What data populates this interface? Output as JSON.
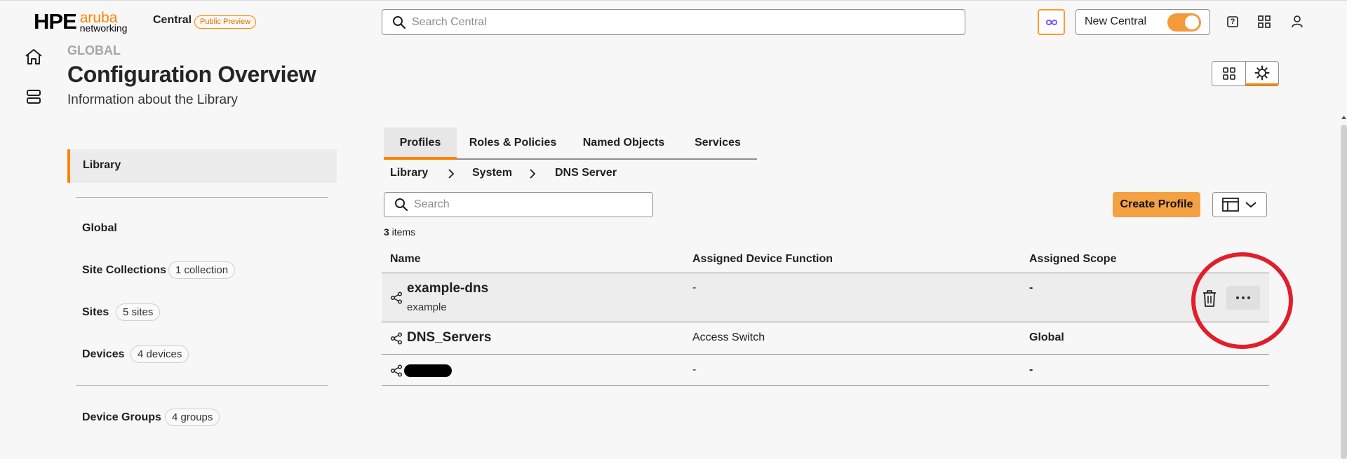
{
  "header": {
    "brand_hpe": "HPE",
    "brand_aruba": "aruba",
    "brand_networking": "networking",
    "app_name": "Central",
    "preview_badge": "Public Preview",
    "search_placeholder": "Search Central",
    "new_central_label": "New Central",
    "new_central_enabled": true,
    "help_glyph": "?"
  },
  "page": {
    "scope": "GLOBAL",
    "title": "Configuration Overview",
    "subtitle": "Information about the Library"
  },
  "left_nav": {
    "active": "Library",
    "items": [
      {
        "label": "Global",
        "count": ""
      },
      {
        "label": "Site Collections",
        "count": "1 collection"
      },
      {
        "label": "Sites",
        "count": "5 sites"
      },
      {
        "label": "Devices",
        "count": "4 devices"
      },
      {
        "label": "Device Groups",
        "count": "4 groups"
      }
    ]
  },
  "tabs": [
    {
      "label": "Profiles",
      "active": true
    },
    {
      "label": "Roles & Policies",
      "active": false
    },
    {
      "label": "Named Objects",
      "active": false
    },
    {
      "label": "Services",
      "active": false
    }
  ],
  "breadcrumb": [
    "Library",
    "System",
    "DNS Server"
  ],
  "toolbar": {
    "search_placeholder": "Search",
    "create_label": "Create Profile"
  },
  "item_count": {
    "number": "3",
    "suffix": " items"
  },
  "table": {
    "columns": [
      "Name",
      "Assigned Device Function",
      "Assigned Scope"
    ],
    "rows": [
      {
        "name": "example-dns",
        "description": "example",
        "device_function": "-",
        "scope": "-"
      },
      {
        "name": "DNS_Servers",
        "description": "",
        "device_function": "Access Switch",
        "scope": "Global"
      },
      {
        "name": "",
        "description": "",
        "device_function": "-",
        "scope": "-",
        "redacted": true
      }
    ]
  },
  "colors": {
    "accent": "#ff8300",
    "primary_button": "#f4a144",
    "annotation": "#e01f2b"
  }
}
